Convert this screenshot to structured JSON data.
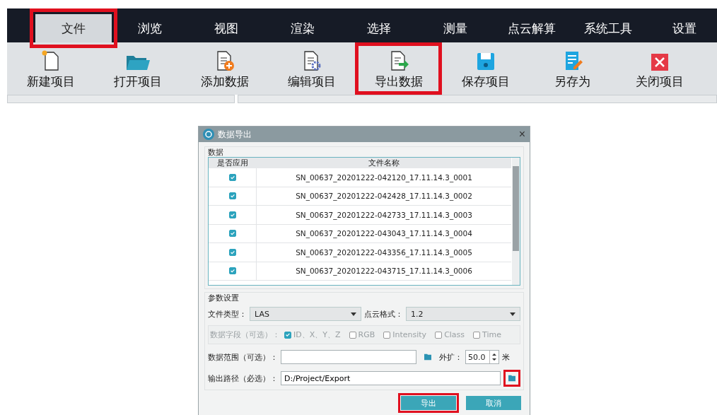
{
  "menu": [
    {
      "label": "文件",
      "selected": true,
      "highlighted": true
    },
    {
      "label": "浏览",
      "selected": false,
      "highlighted": false
    },
    {
      "label": "视图",
      "selected": false,
      "highlighted": false
    },
    {
      "label": "渲染",
      "selected": false,
      "highlighted": false
    },
    {
      "label": "选择",
      "selected": false,
      "highlighted": false
    },
    {
      "label": "测量",
      "selected": false,
      "highlighted": false
    },
    {
      "label": "点云解算",
      "selected": false,
      "highlighted": false
    },
    {
      "label": "系统工具",
      "selected": false,
      "highlighted": false
    },
    {
      "label": "设置",
      "selected": false,
      "highlighted": false
    }
  ],
  "toolbar": [
    {
      "label": "新建项目",
      "kind": "new",
      "highlighted": false
    },
    {
      "label": "打开项目",
      "kind": "open",
      "highlighted": false
    },
    {
      "label": "添加数据",
      "kind": "add",
      "highlighted": false
    },
    {
      "label": "编辑项目",
      "kind": "edit",
      "highlighted": false
    },
    {
      "label": "导出数据",
      "kind": "export",
      "highlighted": true
    },
    {
      "label": "保存项目",
      "kind": "save",
      "highlighted": false
    },
    {
      "label": "另存为",
      "kind": "saveas",
      "highlighted": false
    },
    {
      "label": "关闭项目",
      "kind": "close",
      "highlighted": false
    }
  ],
  "dialog": {
    "title": "数据导出",
    "close": "×",
    "data_group": {
      "title": "数据",
      "columns": [
        "是否应用",
        "文件名称"
      ],
      "rows": [
        {
          "checked": true,
          "name": "SN_00637_20201222-042120_17.11.14.3_0001"
        },
        {
          "checked": true,
          "name": "SN_00637_20201222-042428_17.11.14.3_0002"
        },
        {
          "checked": true,
          "name": "SN_00637_20201222-042733_17.11.14.3_0003"
        },
        {
          "checked": true,
          "name": "SN_00637_20201222-043043_17.11.14.3_0004"
        },
        {
          "checked": true,
          "name": "SN_00637_20201222-043356_17.11.14.3_0005"
        },
        {
          "checked": true,
          "name": "SN_00637_20201222-043715_17.11.14.3_0006"
        }
      ]
    },
    "params": {
      "title": "参数设置",
      "file_type": {
        "label": "文件类型：",
        "value": "LAS"
      },
      "format": {
        "label": "点云格式：",
        "value": "1.2"
      },
      "fields": {
        "label": "数据字段（可选）：",
        "disabled": true,
        "options": [
          {
            "label": "ID、X、Y、Z",
            "checked": true
          },
          {
            "label": "RGB",
            "checked": false
          },
          {
            "label": "Intensity",
            "checked": false
          },
          {
            "label": "Class",
            "checked": false
          },
          {
            "label": "Time",
            "checked": false
          }
        ]
      },
      "range": {
        "label": "数据范围（可选）：",
        "browse_highlighted": false
      },
      "expand": {
        "label": "外扩：",
        "value": "50.0",
        "unit": "米"
      },
      "output": {
        "label": "输出路径（必选）：",
        "value": "D:/Project/Export",
        "browse_highlighted": true
      }
    },
    "buttons": [
      {
        "label": "导出",
        "highlighted": true
      },
      {
        "label": "取消",
        "highlighted": false
      }
    ]
  }
}
